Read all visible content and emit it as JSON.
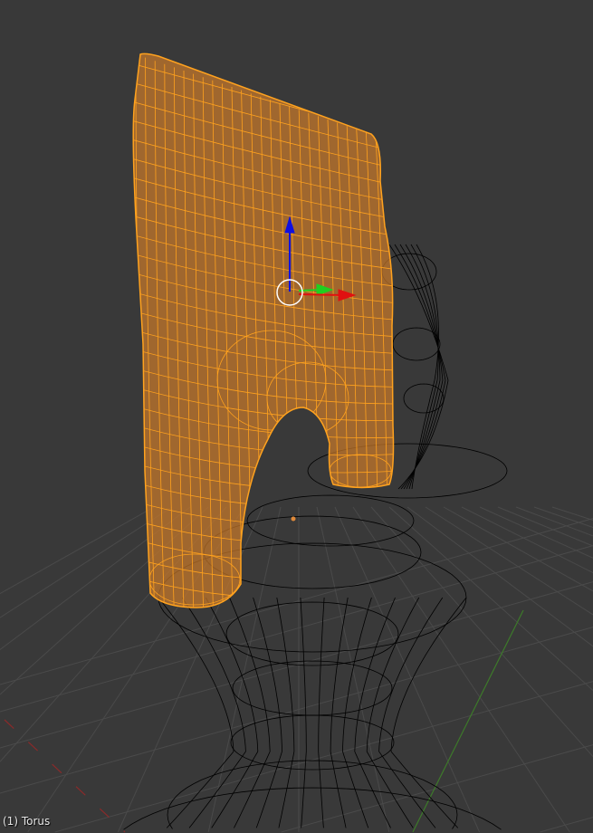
{
  "viewport": {
    "object_label": "(1) Torus",
    "colors": {
      "background": "#393939",
      "grid": "#4a4a4a",
      "x_axis": "#8a2a2a",
      "y_axis": "#3d7a2a",
      "selected_fill": "#c8782a",
      "selected_wire": "#ffa21e",
      "wire": "#000000",
      "gizmo_x": "#e01010",
      "gizmo_y": "#20d020",
      "gizmo_z": "#1010e0",
      "origin": "#e08a3a"
    }
  }
}
